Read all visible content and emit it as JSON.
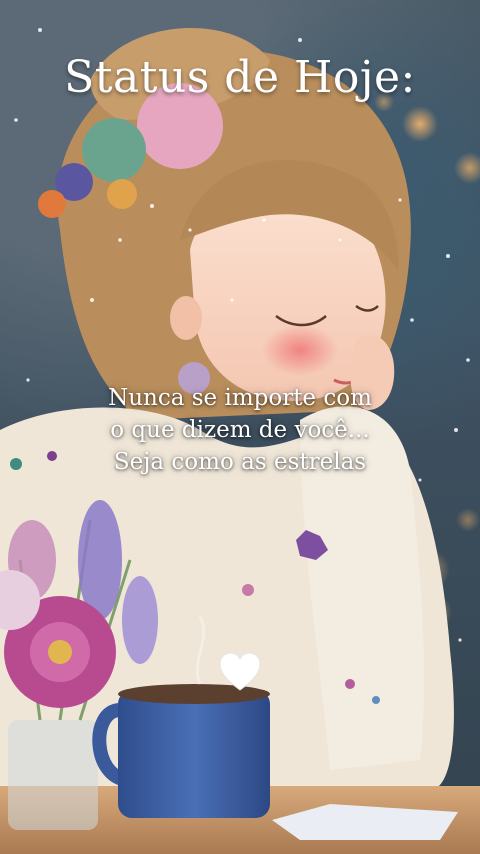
{
  "title": "Status de Hoje:",
  "quote": {
    "line1": "Nunca se importe com",
    "line2": "o que dizem de você...",
    "line3": "Seja como as estrelas"
  },
  "colors": {
    "background": "#3e5060",
    "sweater": "#efe6d8",
    "hair": "#b98e5c",
    "mug": "#3f63a8",
    "table": "#c89a6c",
    "flower": "#b84b8f",
    "lavender": "#8a79c9"
  },
  "icons": [
    "heart-icon"
  ]
}
